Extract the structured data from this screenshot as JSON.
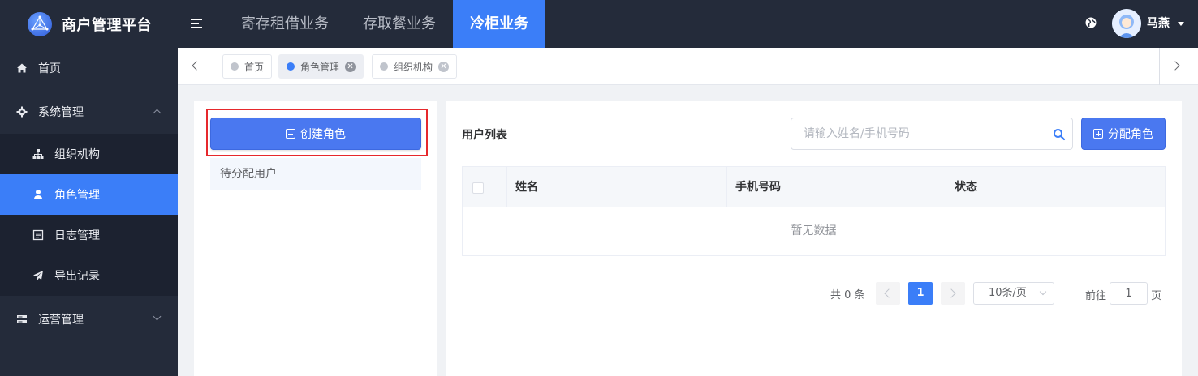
{
  "app": {
    "title": "商户管理平台"
  },
  "topnav": {
    "items": [
      {
        "label": "寄存租借业务"
      },
      {
        "label": "存取餐业务"
      },
      {
        "label": "冷柜业务"
      }
    ],
    "active_index": 2
  },
  "user": {
    "name": "马燕"
  },
  "sidebar": {
    "items": [
      {
        "label": "首页",
        "icon": "home-icon"
      },
      {
        "label": "系统管理",
        "icon": "gear-icon",
        "expanded": true
      },
      {
        "label": "组织机构",
        "icon": "sitemap-icon"
      },
      {
        "label": "角色管理",
        "icon": "user-icon",
        "active": true
      },
      {
        "label": "日志管理",
        "icon": "log-icon"
      },
      {
        "label": "导出记录",
        "icon": "paper-plane-icon"
      },
      {
        "label": "运营管理",
        "icon": "server-icon",
        "expanded": false
      }
    ]
  },
  "tabs": [
    {
      "label": "首页",
      "closable": false
    },
    {
      "label": "角色管理",
      "closable": true,
      "active": true
    },
    {
      "label": "组织机构",
      "closable": true
    }
  ],
  "roles_panel": {
    "create_label": "创建角色",
    "roles": [
      {
        "label": "待分配用户"
      }
    ]
  },
  "users_panel": {
    "title": "用户列表",
    "search_placeholder": "请输入姓名/手机号码",
    "search_value": "",
    "assign_label": "分配角色",
    "columns": [
      "姓名",
      "手机号码",
      "状态"
    ],
    "rows": [],
    "empty_text": "暂无数据"
  },
  "pagination": {
    "total_text": "共 0 条",
    "current_page": "1",
    "page_size_label": "10条/页",
    "goto_prefix": "前往",
    "goto_value": "1",
    "goto_suffix": "页"
  },
  "colors": {
    "accent": "#3b7ef8",
    "topbar": "#242b3a",
    "highlight": "#e6282c"
  }
}
